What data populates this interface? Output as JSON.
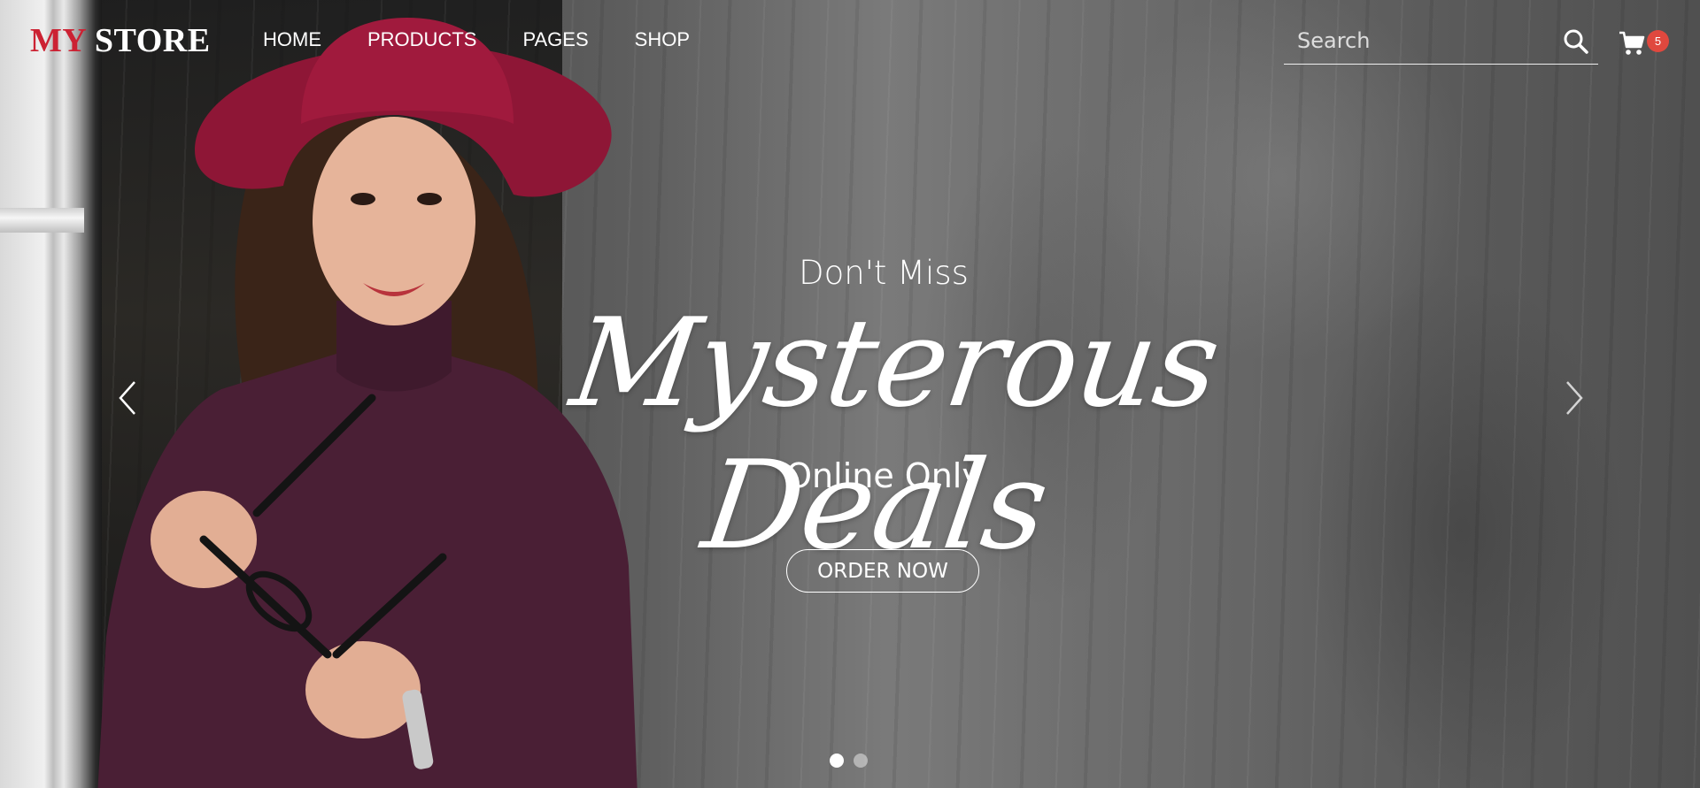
{
  "brand": {
    "prefix": "MY",
    "suffix": "STORE",
    "prefix_color": "#cc2233"
  },
  "nav": {
    "items": [
      {
        "label": "HOME"
      },
      {
        "label": "PRODUCTS"
      },
      {
        "label": "PAGES"
      },
      {
        "label": "SHOP"
      }
    ]
  },
  "search": {
    "placeholder": "Search",
    "icon": "search-icon"
  },
  "cart": {
    "icon": "shopping-cart-icon",
    "count": "5",
    "badge_color": "#e0483e"
  },
  "hero": {
    "pre_title": "Don't Miss",
    "title": "Mysterous Deals",
    "subtitle": "Online Only",
    "cta_label": "ORDER NOW",
    "prev_icon": "chevron-left-icon",
    "next_icon": "chevron-right-icon",
    "slides": {
      "count": 2,
      "active": 1
    }
  }
}
